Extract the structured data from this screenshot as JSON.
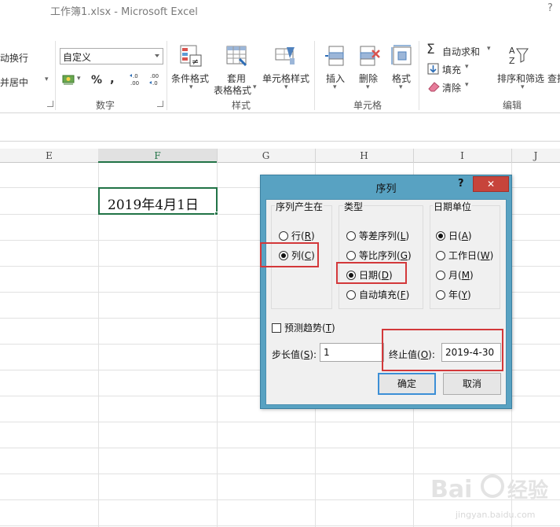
{
  "window": {
    "title": "工作簿1.xlsx - Microsoft Excel",
    "help": "?"
  },
  "ribbon": {
    "alignment": {
      "wrap_text": "动换行",
      "merge_center": "并居中"
    },
    "number": {
      "format_value": "自定义",
      "percent": "%",
      "comma": ",",
      "group_label": "数字"
    },
    "styles": {
      "conditional": "条件格式",
      "table_format_1": "套用",
      "table_format_2": "表格格式",
      "cell_styles": "单元格样式",
      "group_label": "样式"
    },
    "cells": {
      "insert": "插入",
      "delete": "删除",
      "format": "格式",
      "group_label": "单元格"
    },
    "editing": {
      "autosum": "自动求和",
      "fill": "填充",
      "clear": "清除",
      "sort_filter": "排序和筛选",
      "find": "查找",
      "group_label": "编辑"
    }
  },
  "sheet": {
    "columns": [
      "E",
      "F",
      "G",
      "H",
      "I",
      "J"
    ],
    "active_cell_value": "2019年4月1日"
  },
  "dialog": {
    "title": "序列",
    "help": "?",
    "close": "✕",
    "series_in": {
      "title": "序列产生在",
      "row": "行(",
      "row_key": "R",
      "col": "列(",
      "col_key": "C",
      "selected": "col"
    },
    "type": {
      "title": "类型",
      "linear": "等差序列(",
      "linear_key": "L",
      "growth": "等比序列(",
      "growth_key": "G",
      "date": "日期(",
      "date_key": "D",
      "autofill": "自动填充(",
      "autofill_key": "F",
      "selected": "date"
    },
    "date_unit": {
      "title": "日期单位",
      "day": "日(",
      "day_key": "A",
      "weekday": "工作日(",
      "weekday_key": "W",
      "month": "月(",
      "month_key": "M",
      "year": "年(",
      "year_key": "Y",
      "selected": "day"
    },
    "trend": {
      "label": "预测趋势(",
      "key": "T",
      "checked": false
    },
    "step": {
      "label": "步长值(",
      "key": "S",
      "suffix": "):",
      "value": "1"
    },
    "stop": {
      "label": "终止值(",
      "key": "O",
      "suffix": "):",
      "value": "2019-4-30"
    },
    "ok": "确定",
    "cancel": "取消"
  },
  "accent_colors": {
    "highlight_red": "#d3383a",
    "excel_green": "#217346",
    "dialog_frame": "#58a2c2"
  }
}
